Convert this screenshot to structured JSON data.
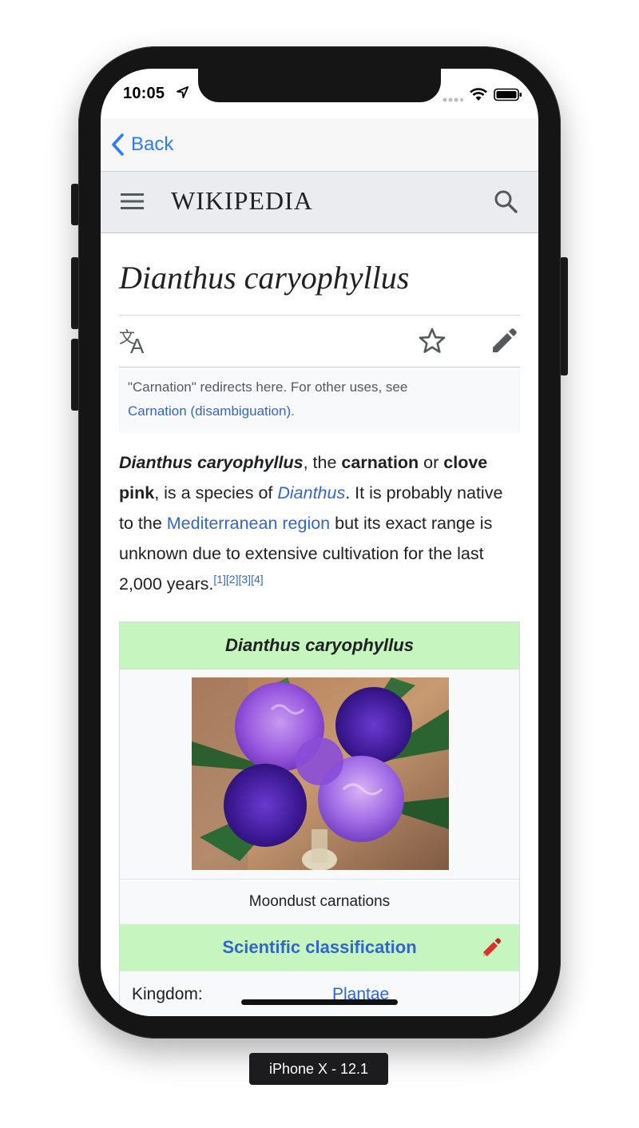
{
  "status_bar": {
    "time": "10:05"
  },
  "navbar": {
    "back_label": "Back"
  },
  "wiki_header": {
    "logo_text": "WIKIPEDIA"
  },
  "article": {
    "title": "Dianthus caryophyllus",
    "hatnote": {
      "text": "\"Carnation\" redirects here. For other uses, see",
      "link": "Carnation (disambiguation)."
    },
    "lead": {
      "subject": "Dianthus caryophyllus",
      "t1": ", the ",
      "carnation": "carnation",
      "t2": " or ",
      "clove_pink": "clove pink",
      "t3": ", is a species of ",
      "genus_link": "Dianthus",
      "t4": ". It is probably native to the ",
      "region_link": "Mediterranean region",
      "t5": " but its exact range is unknown due to extensive cultivation for the last 2,000 years.",
      "refs": [
        "[1]",
        "[2]",
        "[3]",
        "[4]"
      ]
    },
    "infobox": {
      "title": "Dianthus caryophyllus",
      "caption": "Moondust carnations",
      "classification_heading": "Scientific classification",
      "kingdom_label": "Kingdom:",
      "kingdom_value": "Plantae"
    }
  },
  "device_label": "iPhone X - 12.1",
  "colors": {
    "link": "#3366cc",
    "ios_blue": "#2f7cf6",
    "infobox_green": "#c6f5c0",
    "header_gray": "#eaecf0"
  }
}
